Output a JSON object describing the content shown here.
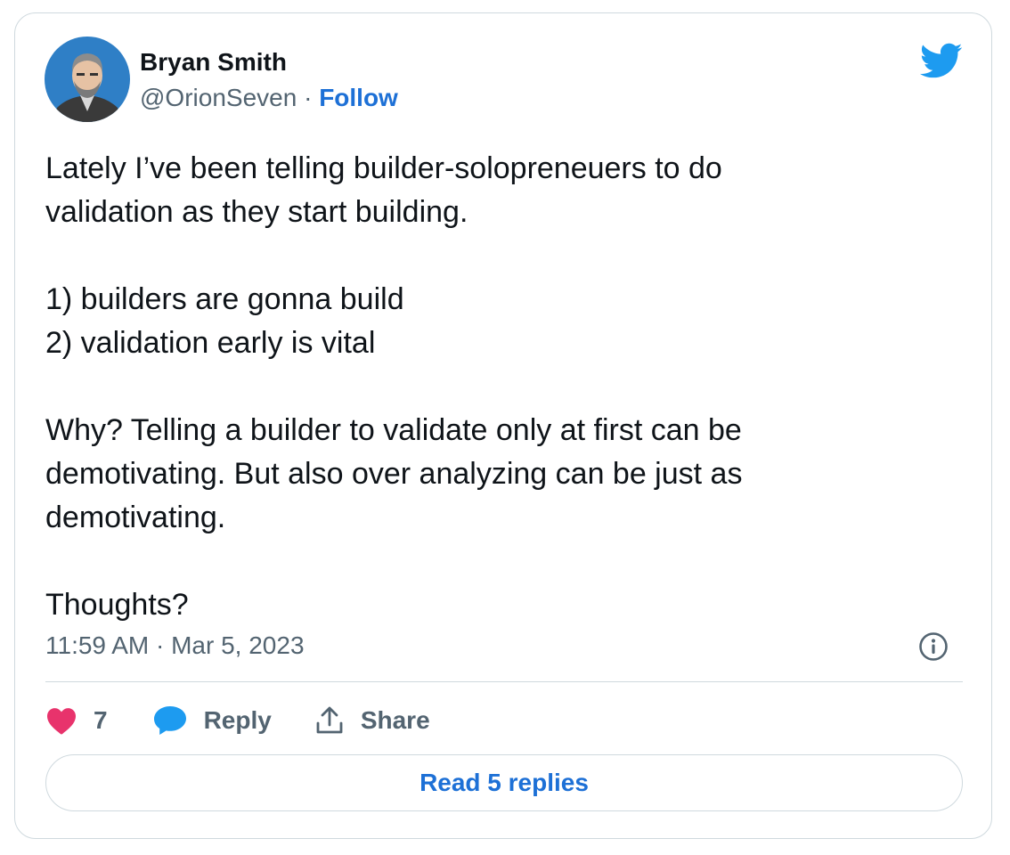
{
  "author": {
    "name": "Bryan Smith",
    "handle": "@OrionSeven",
    "separator": "·",
    "follow_label": "Follow"
  },
  "tweet": {
    "paragraphs": [
      "Lately I’ve been telling builder-solopreneuers to do\nvalidation as they start building.",
      "1) builders are gonna build\n2) validation early is vital",
      "Why? Telling a builder to validate only at first can be\ndemotivating. But also over analyzing can be just as\ndemotivating.",
      "Thoughts?"
    ],
    "timestamp": "11:59 AM · Mar 5, 2023"
  },
  "actions": {
    "like_count": "7",
    "reply_label": "Reply",
    "share_label": "Share"
  },
  "footer": {
    "read_replies_label": "Read 5 replies"
  },
  "icons": {
    "brand": "twitter-bird-icon",
    "info": "info-icon",
    "like": "heart-icon",
    "reply": "speech-bubble-icon",
    "share": "share-upload-icon"
  },
  "colors": {
    "brand_blue": "#1d9bf0",
    "link_blue": "#1d70d6",
    "like_pink": "#e8336c",
    "secondary_text": "#536471",
    "border": "#cfd9de"
  }
}
